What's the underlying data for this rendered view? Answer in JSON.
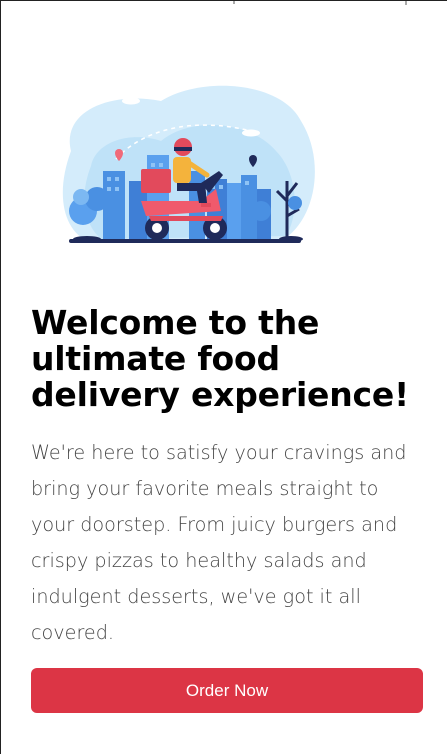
{
  "hero": {
    "illustration_icon": "delivery-scooter-rider-icon",
    "title": "Welcome to the ultimate food delivery experience!",
    "description": "We're here to satisfy your cravings and bring your favorite meals straight to your doorstep. From juicy burgers and crispy pizzas to healthy salads and indulgent desserts, we've got it all covered."
  },
  "actions": {
    "order_now_label": "Order Now"
  },
  "colors": {
    "accent": "#dc3545",
    "title": "#000000",
    "body_text": "#444444",
    "illustration_sky": "#cfe9fb",
    "illustration_city": "#4a90e2"
  }
}
